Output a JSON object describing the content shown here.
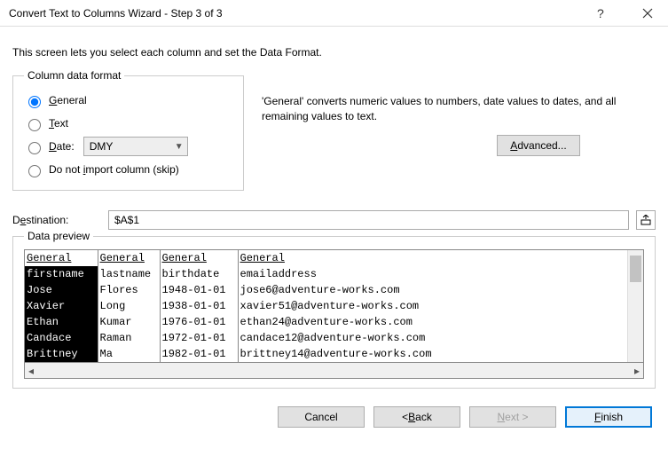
{
  "window": {
    "title": "Convert Text to Columns Wizard - Step 3 of 3"
  },
  "intro": "This screen lets you select each column and set the Data Format.",
  "column_format": {
    "legend": "Column data format",
    "general": "General",
    "text": "Text",
    "date": "Date:",
    "date_value": "DMY",
    "skip": "Do not import column (skip)",
    "selected": "general"
  },
  "description": "'General' converts numeric values to numbers, date values to dates, and all remaining values to text.",
  "advanced_label": "Advanced...",
  "destination": {
    "label": "Destination:",
    "value": "$A$1"
  },
  "preview": {
    "legend": "Data preview",
    "headers": [
      "General",
      "General",
      "General",
      "General"
    ],
    "rows": [
      [
        "firstname",
        "lastname",
        "birthdate",
        "emailaddress"
      ],
      [
        "Jose",
        "Flores",
        "1948-01-01",
        "jose6@adventure-works.com"
      ],
      [
        "Xavier",
        "Long",
        "1938-01-01",
        "xavier51@adventure-works.com"
      ],
      [
        "Ethan",
        "Kumar",
        "1976-01-01",
        "ethan24@adventure-works.com"
      ],
      [
        "Candace",
        "Raman",
        "1972-01-01",
        "candace12@adventure-works.com"
      ],
      [
        "Brittney",
        "Ma",
        "1982-01-01",
        "brittney14@adventure-works.com"
      ]
    ]
  },
  "buttons": {
    "cancel": "Cancel",
    "back": "< Back",
    "next": "Next >",
    "finish": "Finish"
  }
}
